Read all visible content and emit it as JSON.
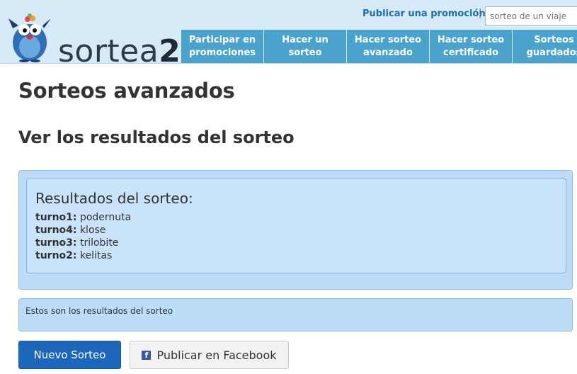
{
  "header": {
    "logo_text_main": "sortea",
    "logo_text_num": "2",
    "promo_link": "Publicar una promoción",
    "separator": "|",
    "search_placeholder": "sorteo de un viaje"
  },
  "nav": {
    "items": [
      {
        "label": "Participar en promociones"
      },
      {
        "label": "Hacer un sorteo"
      },
      {
        "label": "Hacer sorteo avanzado"
      },
      {
        "label": "Hacer sorteo certificado"
      },
      {
        "label": "Sorteos guardados"
      }
    ]
  },
  "main": {
    "title": "Sorteos avanzados",
    "subtitle": "Ver los resultados del sorteo",
    "results_title": "Resultados del sorteo:",
    "results": [
      {
        "key": "turno1:",
        "value": "podernuta"
      },
      {
        "key": "turno4:",
        "value": "klose"
      },
      {
        "key": "turno3:",
        "value": "trilobite"
      },
      {
        "key": "turno2:",
        "value": "kelitas"
      }
    ],
    "note": "Estos son los resultados del sorteo",
    "new_button": "Nuevo Sorteo",
    "fb_button": "Publicar en Facebook",
    "fb_icon_glyph": "f"
  },
  "colors": {
    "header_bg": "#d6eaf8",
    "nav_bg": "#4aa3cc",
    "panel_bg": "#bcdcf7",
    "primary_button": "#1c67bb",
    "facebook": "#3b5998"
  }
}
